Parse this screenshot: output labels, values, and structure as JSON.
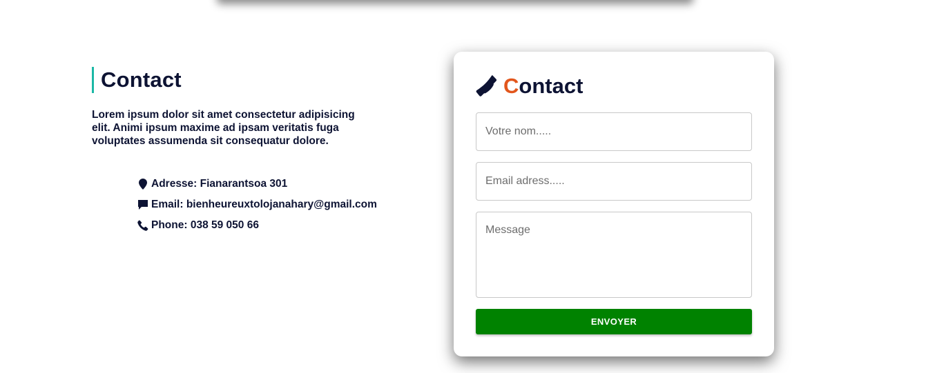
{
  "left": {
    "title": "Contact",
    "description": "Lorem ipsum dolor sit amet consectetur adipisicing elit. Animi ipsum maxime ad ipsam veritatis fuga voluptates assumenda sit consequatur dolore.",
    "info": [
      {
        "icon": "map-marker-icon",
        "text": "Adresse: Fianarantsoa 301"
      },
      {
        "icon": "message-icon",
        "text": "Email: bienheureuxtolojanahary@gmail.com"
      },
      {
        "icon": "phone-icon",
        "text": "Phone: 038 59 050 66"
      }
    ],
    "accent_color": "#1bb8a6"
  },
  "form": {
    "title_first": "C",
    "title_rest": "ontact",
    "title_icon": "phone-icon",
    "title_first_color": "#e2561c",
    "name_placeholder": "Votre nom.....",
    "email_placeholder": "Email adress.....",
    "message_placeholder": "Message",
    "submit_label": "ENVOYER",
    "submit_color": "#008200"
  }
}
